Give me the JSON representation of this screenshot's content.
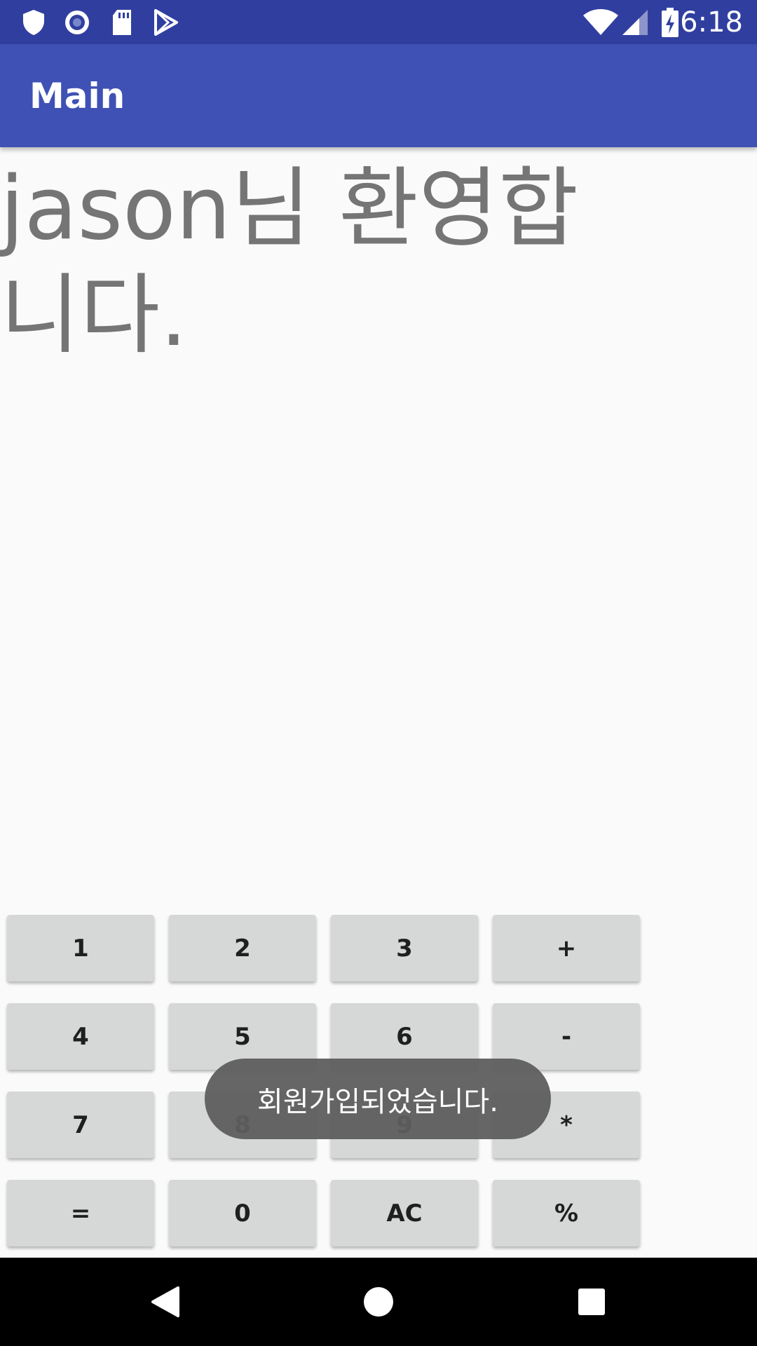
{
  "status_bar": {
    "time": "6:18",
    "left_icons": [
      "shield-icon",
      "vpn-circle-icon",
      "sd-card-icon",
      "play-store-icon"
    ],
    "right_icons": [
      "wifi-icon",
      "signal-icon",
      "battery-charging-icon"
    ],
    "background_color": "#303f9f"
  },
  "app_bar": {
    "title": "Main",
    "background_color": "#3f51b5"
  },
  "main": {
    "welcome_text": "jason님 환영합니다."
  },
  "calculator": {
    "buttons": [
      {
        "label": "1"
      },
      {
        "label": "2"
      },
      {
        "label": "3"
      },
      {
        "label": "+"
      },
      {
        "label": "4"
      },
      {
        "label": "5"
      },
      {
        "label": "6"
      },
      {
        "label": "-"
      },
      {
        "label": "7"
      },
      {
        "label": "8"
      },
      {
        "label": "9"
      },
      {
        "label": "*"
      },
      {
        "label": "="
      },
      {
        "label": "0"
      },
      {
        "label": "AC"
      },
      {
        "label": "%"
      }
    ]
  },
  "toast": {
    "message": "회원가입되었습니다."
  },
  "nav_bar": {
    "buttons": [
      "back-icon",
      "home-icon",
      "recents-icon"
    ]
  }
}
